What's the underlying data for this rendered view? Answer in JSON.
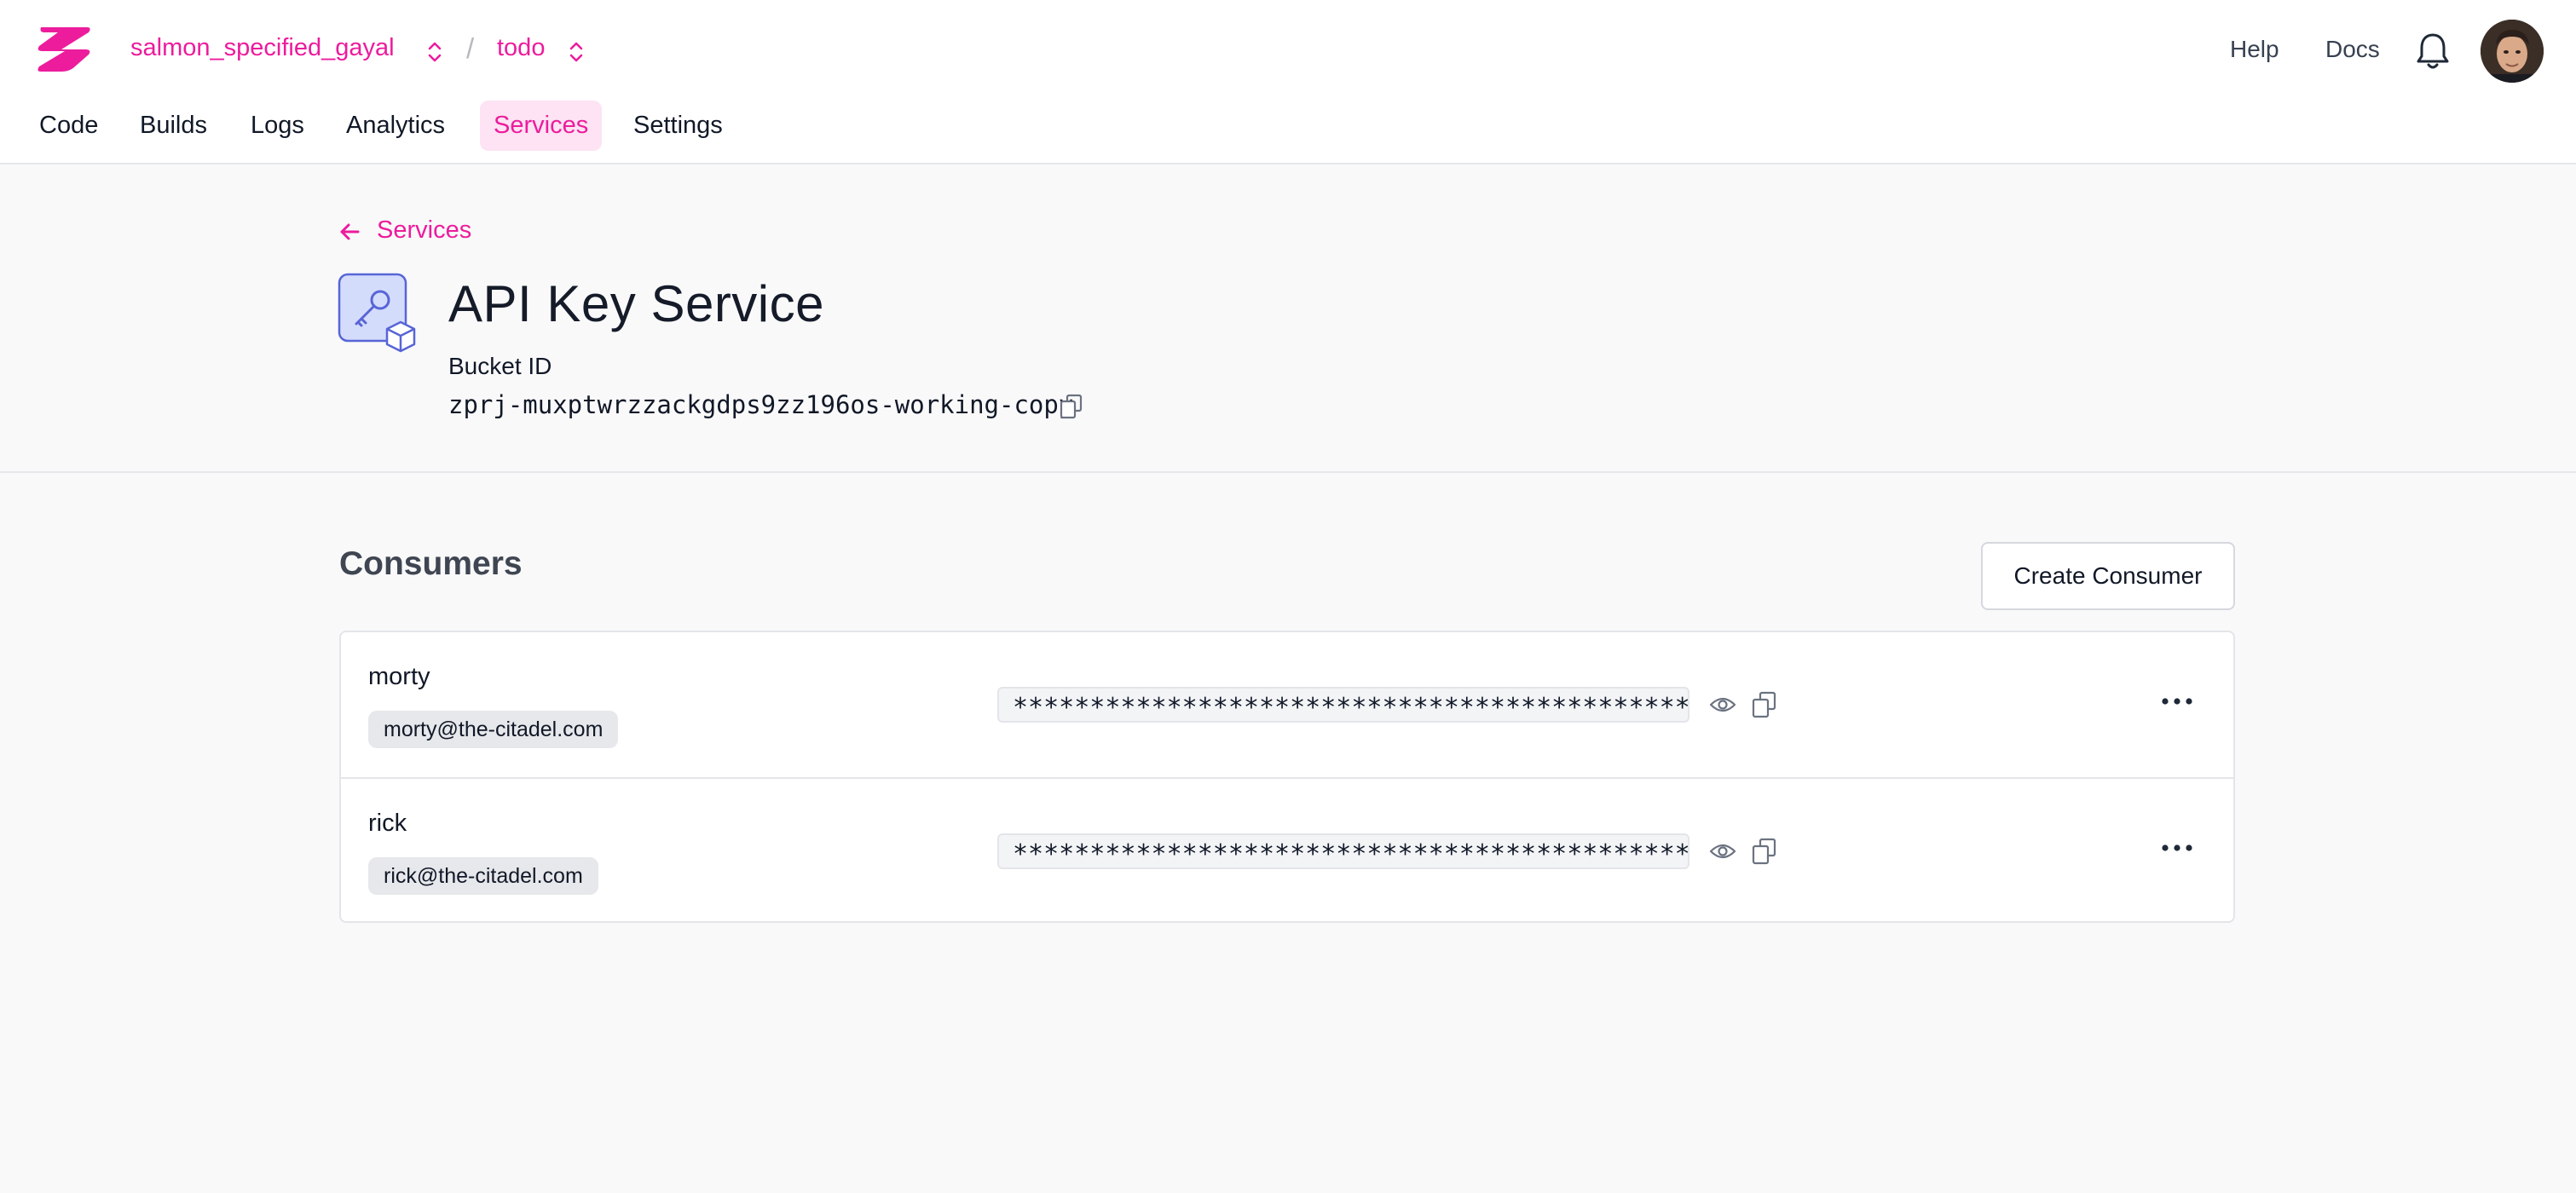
{
  "header": {
    "org": "salmon_specified_gayal",
    "separator": "/",
    "project": "todo",
    "help": "Help",
    "docs": "Docs"
  },
  "tabs": [
    {
      "label": "Code",
      "active": false
    },
    {
      "label": "Builds",
      "active": false
    },
    {
      "label": "Logs",
      "active": false
    },
    {
      "label": "Analytics",
      "active": false
    },
    {
      "label": "Services",
      "active": true
    },
    {
      "label": "Settings",
      "active": false
    }
  ],
  "service": {
    "back_label": "Services",
    "title": "API Key Service",
    "bucket_label": "Bucket ID",
    "bucket_id": "zprj-muxptwrzzackgdps9zz196os-working-copy"
  },
  "consumers": {
    "title": "Consumers",
    "create_label": "Create Consumer",
    "rows": [
      {
        "name": "morty",
        "email": "morty@the-citadel.com",
        "key_masked": "**********************************************"
      },
      {
        "name": "rick",
        "email": "rick@the-citadel.com",
        "key_masked": "**********************************************"
      }
    ]
  },
  "colors": {
    "accent": "#ec1c9d",
    "accent_bg": "#fde3f3",
    "service_icon_bg": "#d4dcfb",
    "service_icon_stroke": "#5865d6"
  },
  "icons": [
    "zuplo-logo",
    "chevron-updown-icon",
    "bell-icon",
    "avatar",
    "arrow-left-icon",
    "api-key-service-icon",
    "copy-icon",
    "eye-icon",
    "more-horizontal-icon"
  ]
}
